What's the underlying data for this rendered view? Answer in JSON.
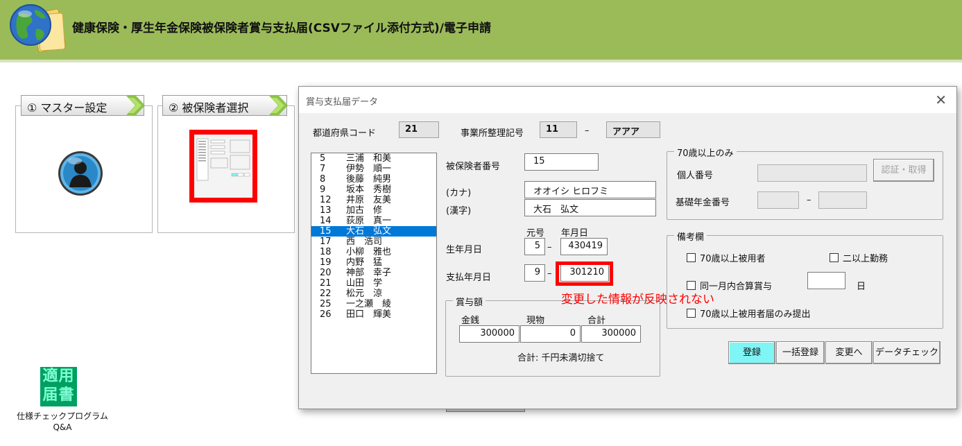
{
  "app": {
    "title": "健康保険・厚生年金保険被保険者賞与支払届(CSVファイル添付方式)/電子申請"
  },
  "steps": [
    {
      "label": "① マスター設定"
    },
    {
      "label": "② 被保険者選択"
    }
  ],
  "side": {
    "badge_line1": "適用",
    "badge_line2": "届書",
    "label_line1": "仕様チェックプログラム",
    "label_line2": "Q&A"
  },
  "dialog": {
    "title": "賞与支払届データ",
    "close": "✕",
    "pref_code_label": "都道府県コード",
    "pref_code": "21",
    "office_label": "事業所整理記号",
    "office_code": "11",
    "office_dash": "–",
    "office_name": "アアア",
    "list": [
      {
        "num": "5",
        "name": "三浦　和美"
      },
      {
        "num": "7",
        "name": "伊勢　順一"
      },
      {
        "num": "8",
        "name": "後藤　純男"
      },
      {
        "num": "9",
        "name": "坂本　秀樹"
      },
      {
        "num": "12",
        "name": "井原　友美"
      },
      {
        "num": "13",
        "name": "加古　修"
      },
      {
        "num": "14",
        "name": "荻原　真一"
      },
      {
        "num": "15",
        "name": "大石　弘文"
      },
      {
        "num": "17",
        "name": "西　浩司"
      },
      {
        "num": "18",
        "name": "小柳　雅也"
      },
      {
        "num": "19",
        "name": "内野　猛"
      },
      {
        "num": "20",
        "name": "神部　幸子"
      },
      {
        "num": "21",
        "name": "山田　学"
      },
      {
        "num": "22",
        "name": "松元　涼"
      },
      {
        "num": "25",
        "name": "一之瀬　綾"
      },
      {
        "num": "26",
        "name": "田口　輝美"
      }
    ],
    "selected_index": 7,
    "insured_no_label": "被保険者番号",
    "insured_no": "15",
    "kana_label": "(カナ)",
    "kana": "オオイシ ヒロフミ",
    "kanji_label": "(漢字)",
    "kanji": "大石　弘文",
    "era_header": "元号",
    "ymd_header": "年月日",
    "birth_label": "生年月日",
    "birth_era": "5",
    "birth_date": "430419",
    "pay_label": "支払年月日",
    "pay_era": "9",
    "pay_date": "301210",
    "dash": "–",
    "bonus_group": "賞与額",
    "cash_label": "金銭",
    "goods_label": "現物",
    "total_label": "合計",
    "cash": "300000",
    "goods": "0",
    "total": "300000",
    "total_note": "合計: 千円未満切捨て",
    "over70_group": "70歳以上のみ",
    "personal_no_label": "個人番号",
    "auth_button": "認証・取得",
    "pension_no_label": "基礎年金番号",
    "pension_dash": "–",
    "remarks_group": "備考欄",
    "chk_over70": "70歳以上被用者",
    "chk_multi": "二以上勤務",
    "chk_same_month": "同一月内合算賞与",
    "day_unit": "日",
    "chk_over70_only": "70歳以上被用者届のみ提出",
    "btn_register": "登録",
    "btn_bulk": "一括登録",
    "btn_change": "変更へ",
    "btn_check": "データチェック",
    "annotation": "変更した情報が反映されない"
  },
  "colors": {
    "header": "#9bbb59",
    "highlight": "#ff0000",
    "selection": "#0078d7",
    "primary_button": "#7ff5f5"
  }
}
